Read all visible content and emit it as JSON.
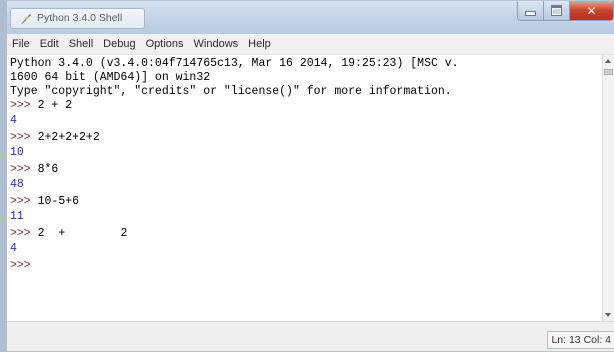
{
  "window": {
    "title": "Python 3.4.0 Shell"
  },
  "menu": {
    "items": [
      "File",
      "Edit",
      "Shell",
      "Debug",
      "Options",
      "Windows",
      "Help"
    ]
  },
  "shell": {
    "banner": [
      "Python 3.4.0 (v3.4.0:04f714765c13, Mar 16 2014, 19:25:23) [MSC v.",
      "1600 64 bit (AMD64)] on win32",
      "Type \"copyright\", \"credits\" or \"license()\" for more information."
    ],
    "prompt": ">>>",
    "entries": [
      {
        "input": "2 + 2",
        "output": "4"
      },
      {
        "input": "2+2+2+2+2",
        "output": "10"
      },
      {
        "input": "8*6",
        "output": "48"
      },
      {
        "input": "10-5+6",
        "output": "11"
      },
      {
        "input": "2  +        2",
        "output": "4"
      }
    ],
    "final_prompt": ">>>"
  },
  "status": {
    "position": "Ln: 13 Col: 4"
  },
  "colors": {
    "prompt": "#7a2a2a",
    "output": "#2b2bd4",
    "close_button": "#c8452e"
  },
  "icons": {
    "app": "python-feather-icon",
    "minimize": "minimize-icon",
    "maximize": "maximize-icon",
    "close": "close-icon"
  }
}
